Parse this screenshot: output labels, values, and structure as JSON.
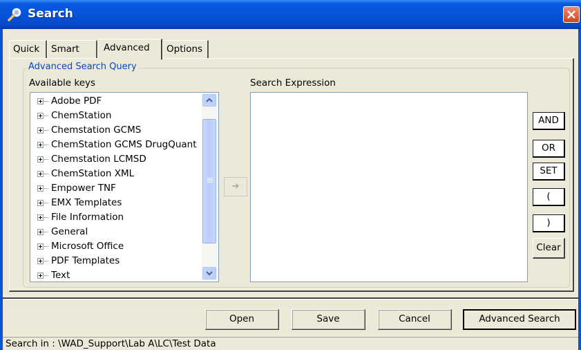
{
  "window": {
    "title": "Search"
  },
  "tabs": [
    {
      "label": "Quick"
    },
    {
      "label": "Smart"
    },
    {
      "label": "Advanced",
      "active": true
    },
    {
      "label": "Options"
    }
  ],
  "group": {
    "title": "Advanced Search Query"
  },
  "keys": {
    "label": "Available keys",
    "items": [
      "Adobe PDF",
      "ChemStation",
      "Chemstation GCMS",
      "ChemStation GCMS DrugQuant",
      "Chemstation LCMSD",
      "ChemStation XML",
      "Empower TNF",
      "EMX Templates",
      "File Information",
      "General",
      "Microsoft Office",
      "PDF Templates",
      "Text"
    ]
  },
  "expression": {
    "label": "Search Expression",
    "value": ""
  },
  "operators": {
    "and": "AND",
    "or": "OR",
    "set": "SET",
    "open_paren": "(",
    "close_paren": ")",
    "clear": "Clear"
  },
  "add_arrow": "➔",
  "buttons": {
    "open": "Open",
    "save": "Save",
    "cancel": "Cancel",
    "advanced_search": "Advanced Search"
  },
  "status": {
    "text": "Search in : \\WAD_Support\\Lab A\\LC\\Test Data"
  },
  "colors": {
    "titlebar": "#0553d8",
    "group_title": "#0046d5",
    "face": "#ece9d8",
    "close": "#d3451b"
  }
}
